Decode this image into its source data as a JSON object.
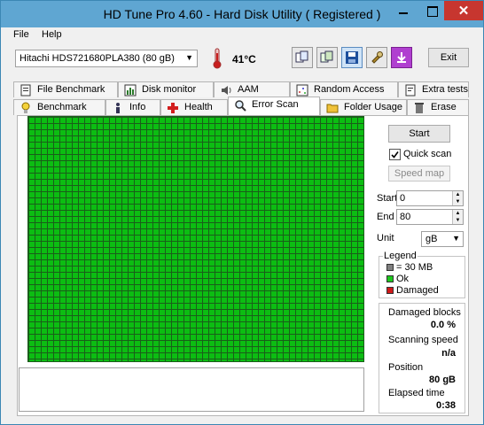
{
  "window": {
    "title": "HD Tune Pro 4.60 - Hard Disk Utility (  Registered  )",
    "close_glyph": "✕"
  },
  "menu": {
    "file": "File",
    "help": "Help"
  },
  "toolbar": {
    "drive": "Hitachi HDS721680PLA380 (80 gB)",
    "temperature": "41°C",
    "exit_label": "Exit"
  },
  "tabs_top": [
    {
      "label": "File Benchmark",
      "icon": "file-benchmark-icon"
    },
    {
      "label": "Disk monitor",
      "icon": "disk-monitor-icon"
    },
    {
      "label": "AAM",
      "icon": "speaker-icon"
    },
    {
      "label": "Random Access",
      "icon": "random-access-icon"
    },
    {
      "label": "Extra tests",
      "icon": "extra-tests-icon"
    }
  ],
  "tabs_bottom": [
    {
      "label": "Benchmark",
      "icon": "benchmark-icon"
    },
    {
      "label": "Info",
      "icon": "info-icon"
    },
    {
      "label": "Health",
      "icon": "health-icon"
    },
    {
      "label": "Error Scan",
      "icon": "magnifier-icon",
      "active": true
    },
    {
      "label": "Folder Usage",
      "icon": "folder-icon"
    },
    {
      "label": "Erase",
      "icon": "trash-icon"
    }
  ],
  "scan": {
    "start_label": "Start",
    "quick_scan_label": "Quick scan",
    "quick_scan_checked": true,
    "speed_map_label": "Speed map",
    "start_field_label": "Start",
    "start_value": "0",
    "end_field_label": "End",
    "end_value": "80",
    "unit_label": "Unit",
    "unit_value": "gB"
  },
  "legend": {
    "title": "Legend",
    "items": [
      {
        "label": "= 30 MB",
        "color": "#808080"
      },
      {
        "label": "Ok",
        "color": "#1ec81e"
      },
      {
        "label": "Damaged",
        "color": "#d01818"
      }
    ]
  },
  "stats": {
    "damaged_label": "Damaged blocks",
    "damaged_value": "0.0 %",
    "speed_label": "Scanning speed",
    "speed_value": "n/a",
    "position_label": "Position",
    "position_value": "80 gB",
    "elapsed_label": "Elapsed time",
    "elapsed_value": "0:38"
  },
  "colors": {
    "ok_block": "#0cbd12",
    "grid_line": "#1a5e1a",
    "titlebar": "#5fa6d2"
  }
}
